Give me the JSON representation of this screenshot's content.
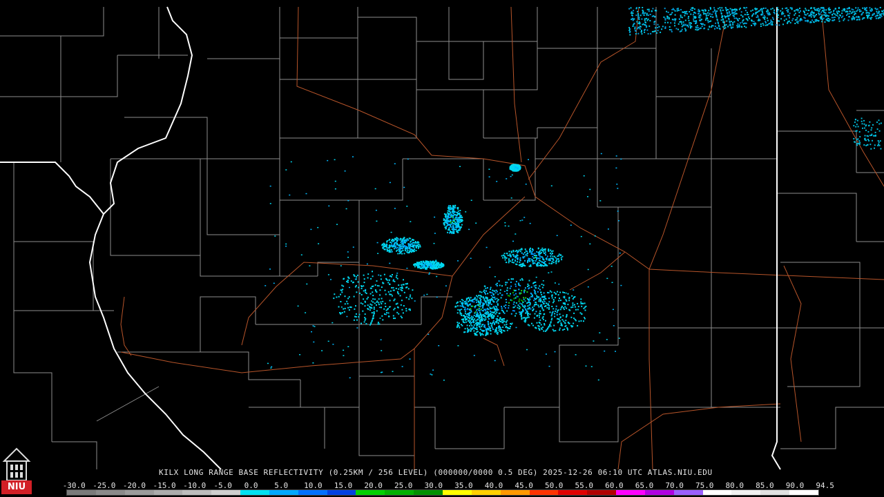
{
  "product": {
    "caption": "KILX LONG RANGE BASE REFLECTIVITY (0.25KM / 256 LEVEL) (000000/0000 0.5 DEG) 2025-12-26 06:10 UTC  ATLAS.NIU.EDU"
  },
  "scale": {
    "tick_labels": [
      "-30.0",
      "-25.0",
      "-20.0",
      "-15.0",
      "-10.0",
      "-5.0",
      "0.0",
      "5.0",
      "10.0",
      "15.0",
      "20.0",
      "25.0",
      "30.0",
      "35.0",
      "40.0",
      "45.0",
      "50.0",
      "55.0",
      "60.0",
      "65.0",
      "70.0",
      "75.0",
      "80.0",
      "85.0",
      "90.0",
      "94.5"
    ],
    "colors": [
      "#7a7a7a",
      "#8a8a8a",
      "#9b9b9b",
      "#acacac",
      "#bdbdbd",
      "#cfcfcf",
      "#00e0f0",
      "#00a8ff",
      "#0070ff",
      "#0040e0",
      "#00d000",
      "#00b000",
      "#009000",
      "#ffff00",
      "#ffd000",
      "#ff9900",
      "#ff3300",
      "#e00000",
      "#b00000",
      "#ff00ff",
      "#b000e0",
      "#9a60ff",
      "#ffffff",
      "#f0f0f0",
      "#e0e0e0",
      "#ffffff"
    ]
  },
  "logo": {
    "text": "NIU"
  }
}
